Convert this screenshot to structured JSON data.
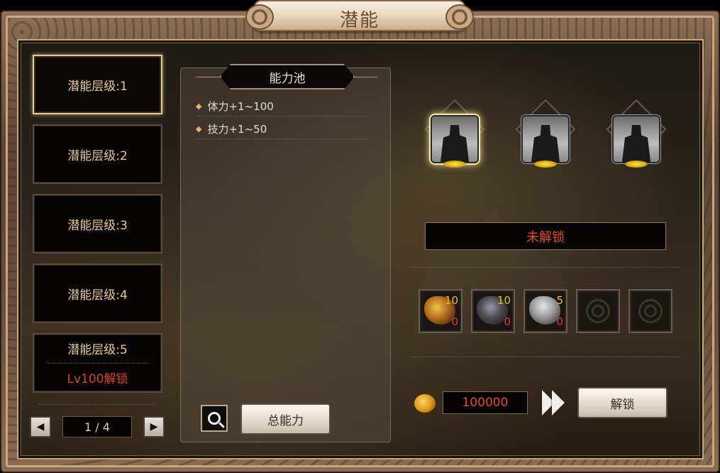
{
  "window": {
    "title": "潜能"
  },
  "levels": [
    {
      "label": "潜能层级:1",
      "active": true
    },
    {
      "label": "潜能层级:2",
      "active": false
    },
    {
      "label": "潜能层级:3",
      "active": false
    },
    {
      "label": "潜能层级:4",
      "active": false
    },
    {
      "label": "潜能层级:5",
      "active": false,
      "lock_text": "Lv100解锁"
    }
  ],
  "pager": {
    "page_text": "1 / 4",
    "prev_icon": "arrow-left-icon",
    "next_icon": "arrow-right-icon"
  },
  "pool": {
    "header": "能力池",
    "stats": [
      {
        "text": "体力+1~100"
      },
      {
        "text": "技力+1~50"
      }
    ],
    "search_icon": "magnifier-icon",
    "total_button": "总能力"
  },
  "skills": [
    {
      "icon": "warrior-silhouette-icon",
      "selected": true
    },
    {
      "icon": "lightning-warrior-icon",
      "selected": false
    },
    {
      "icon": "storm-warrior-icon",
      "selected": false
    }
  ],
  "status": {
    "text": "未解锁",
    "color": "#e24a2e"
  },
  "materials": [
    {
      "icon": "gold-ore-icon",
      "required": "10",
      "owned": "0"
    },
    {
      "icon": "dark-ore-icon",
      "required": "10",
      "owned": "0"
    },
    {
      "icon": "stone-idol-icon",
      "required": "5",
      "owned": "0"
    },
    {
      "icon": "empty-slot-icon",
      "required": "",
      "owned": ""
    },
    {
      "icon": "empty-slot-icon",
      "required": "",
      "owned": ""
    }
  ],
  "cost": {
    "icon": "gold-coin-icon",
    "value": "100000"
  },
  "unlock_button": "解锁",
  "colors": {
    "accent_gold": "#e8c98c",
    "lock_red": "#e04030",
    "material_count": "#f2b92a"
  }
}
